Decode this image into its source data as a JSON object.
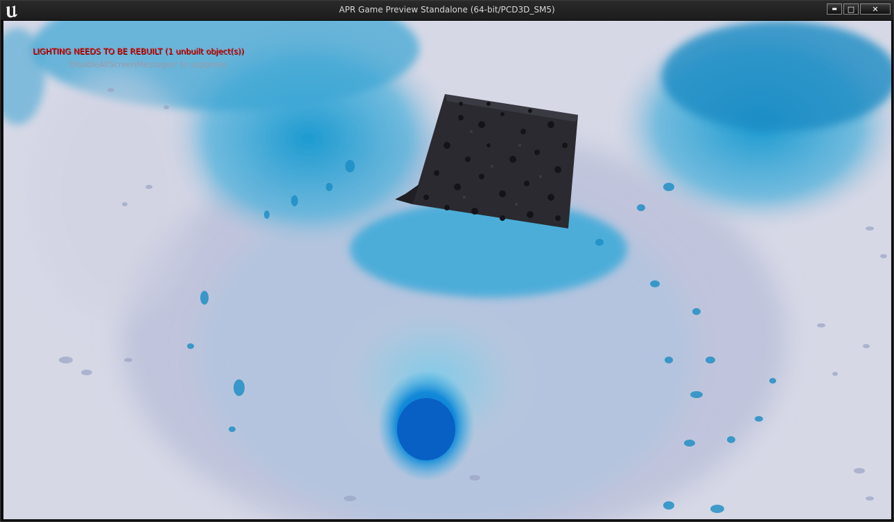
{
  "window": {
    "title": "APR Game Preview Standalone (64-bit/PCD3D_SM5)",
    "logo_icon": "unreal-engine-logo-icon",
    "buttons": {
      "minimize": "▬",
      "maximize": "□",
      "close": "✕"
    }
  },
  "viewport": {
    "messages": {
      "lighting_warning": "LIGHTING NEEDS TO BE REBUILT (1 unbuilt object(s))",
      "suppress_hint": "'DisableAllScreenMessages' to suppress"
    },
    "colors": {
      "background": "#d6d8e6",
      "particle_blue": "#1a9ad0",
      "deep_blue": "#0a6fd0",
      "cube": "#2a2a30",
      "warning_text": "#e01818"
    }
  }
}
